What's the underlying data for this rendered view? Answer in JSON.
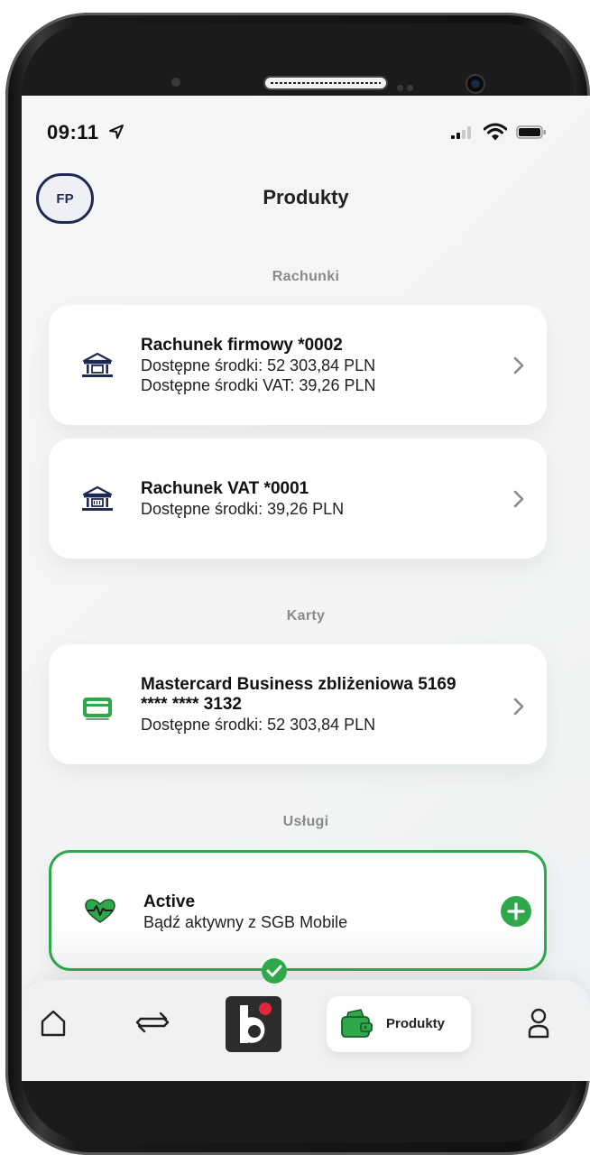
{
  "status_bar": {
    "time": "09:11"
  },
  "header": {
    "avatar_initials": "FP",
    "title": "Produkty"
  },
  "sections": {
    "accounts": "Rachunki",
    "cards": "Karty",
    "services": "Usługi"
  },
  "accounts": [
    {
      "title": "Rachunek firmowy *0002",
      "lines": [
        "Dostępne środki: 52 303,84 PLN",
        "Dostępne środki VAT: 39,26 PLN"
      ],
      "icon": "bank-icon"
    },
    {
      "title": "Rachunek VAT *0001",
      "lines": [
        "Dostępne środki: 39,26 PLN"
      ],
      "icon": "bank-vat-icon"
    }
  ],
  "cards": [
    {
      "title_line1": "Mastercard Business zbliżeniowa 5169",
      "title_line2": "**** **** 3132",
      "lines": [
        "Dostępne środki: 52 303,84 PLN"
      ],
      "icon": "card-icon"
    }
  ],
  "services": [
    {
      "title": "Active",
      "subtitle": "Bądź aktywny z SGB Mobile",
      "icon": "heart-pulse-icon",
      "action_icon": "plus-icon"
    }
  ],
  "tabbar": {
    "items": [
      {
        "name": "home",
        "icon": "home-icon"
      },
      {
        "name": "transfer",
        "icon": "transfer-icon"
      },
      {
        "name": "logo",
        "icon": "bs-logo-icon"
      },
      {
        "name": "products",
        "icon": "wallet-icon",
        "label": "Produkty",
        "active": true
      },
      {
        "name": "profile",
        "icon": "user-icon"
      }
    ]
  },
  "colors": {
    "accent_green": "#2ea84a",
    "navy": "#1e2a55",
    "logo_red": "#e0263a"
  }
}
